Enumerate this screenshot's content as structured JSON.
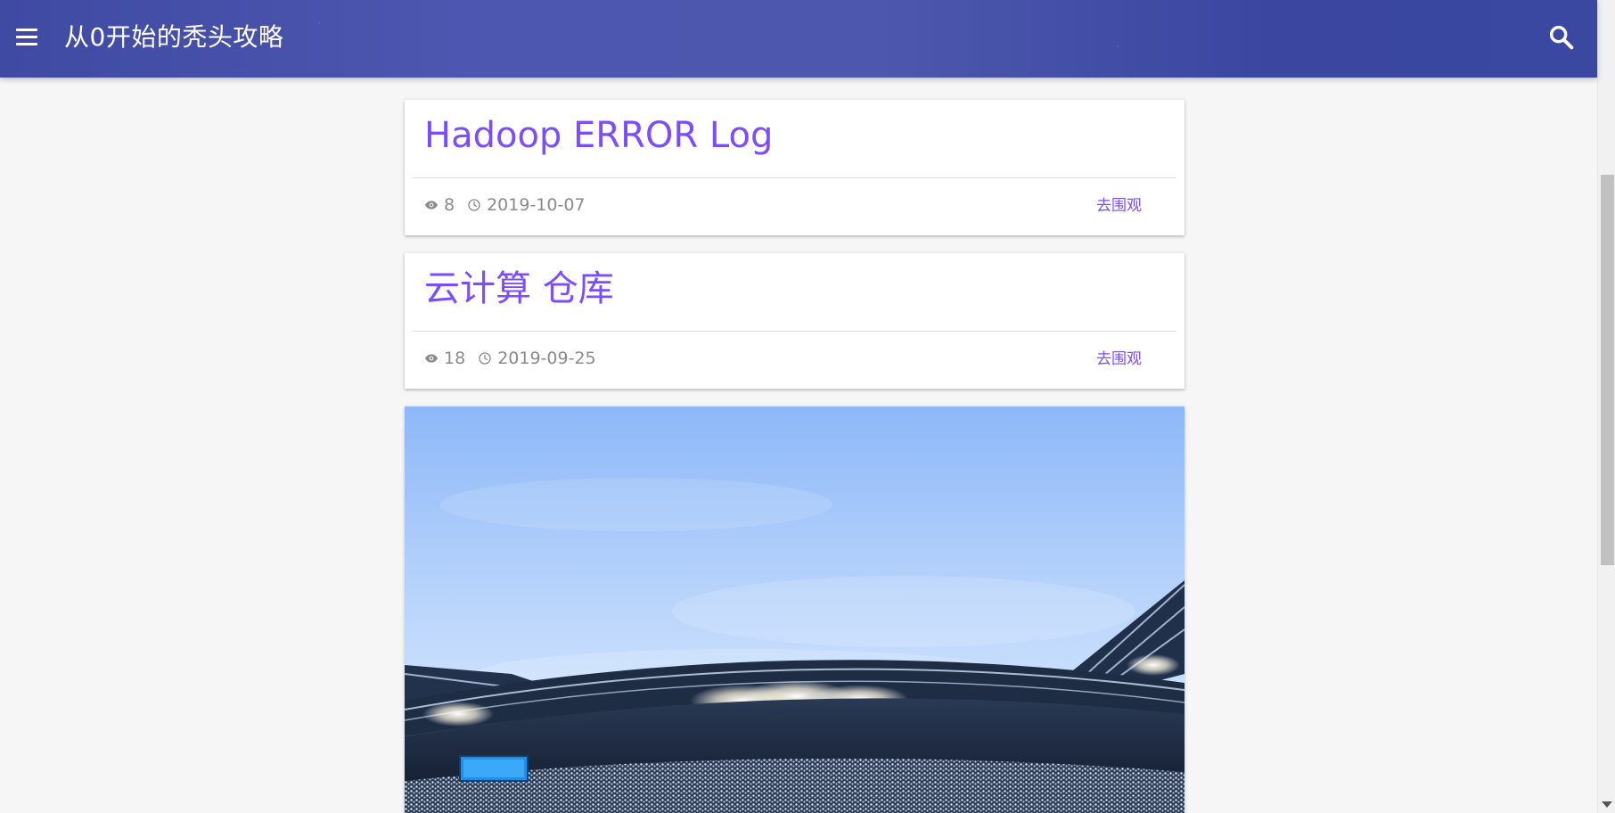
{
  "header": {
    "site_title": "从0开始的秃头攻略"
  },
  "posts": [
    {
      "title": "Hadoop ERROR Log",
      "views": "8",
      "date": "2019-10-07",
      "link_label": "去围观"
    },
    {
      "title": "云计算 仓库",
      "views": "18",
      "date": "2019-09-25",
      "link_label": "去围观"
    }
  ],
  "colors": {
    "accent": "#7c4dff",
    "header": "#4a54ab",
    "meta_text": "#8a8a8a",
    "background": "#f6f6f6"
  },
  "icons": {
    "menu": "menu-icon",
    "search": "search-icon",
    "views": "eye-icon",
    "date": "clock-icon"
  }
}
